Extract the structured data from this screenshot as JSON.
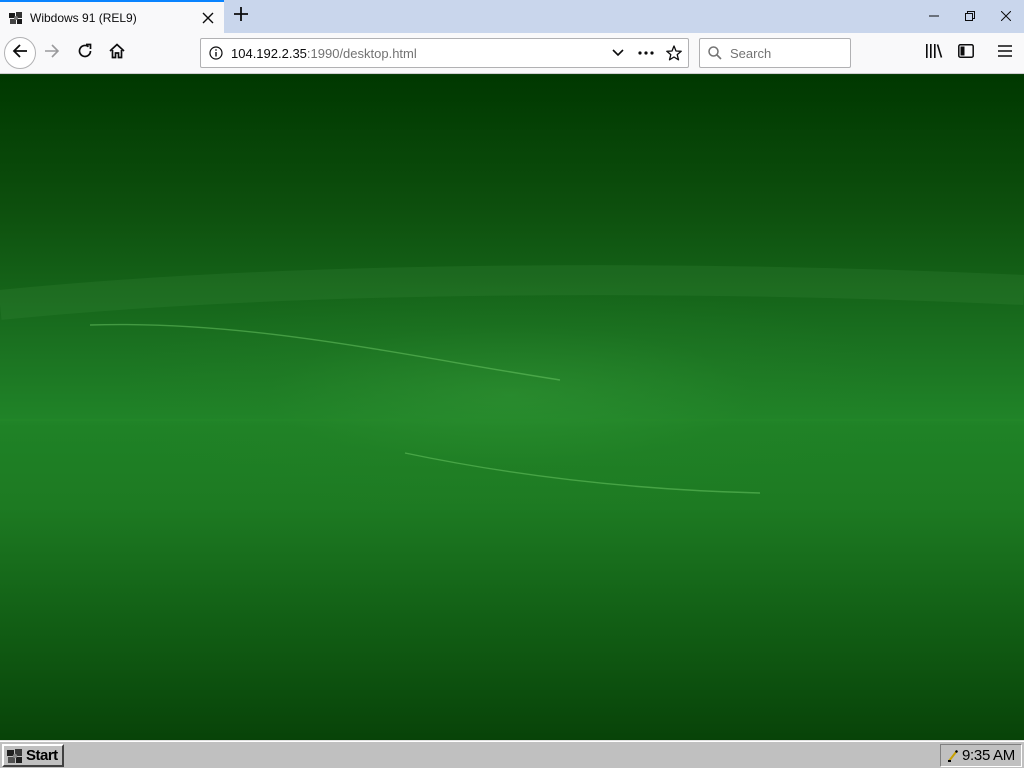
{
  "browser": {
    "tab": {
      "title": "Wibdows 91 (REL9)",
      "favicon": "wibdows-logo-icon"
    },
    "new_tab_icon": "plus-icon",
    "window_controls": [
      "minimize-icon",
      "restore-icon",
      "close-icon"
    ],
    "nav": {
      "back_icon": "arrow-left-icon",
      "forward_icon": "arrow-right-icon",
      "reload_icon": "reload-icon",
      "home_icon": "home-icon"
    },
    "urlbar": {
      "host": "104.192.2.35",
      "rest": ":1990/desktop.html",
      "info_icon": "info-icon",
      "actions": [
        "chevron-down-icon",
        "more-icon",
        "star-icon"
      ]
    },
    "search": {
      "placeholder": "Search",
      "value": ""
    },
    "toolbar": [
      "library-icon",
      "sidebar-icon",
      "hamburger-menu-icon"
    ]
  },
  "taskbar": {
    "start_label": "Start",
    "clock": "9:35 AM",
    "tray_icon": "speaker-icon"
  },
  "colors": {
    "desktop_top": "#003800",
    "desktop_mid": "#208428",
    "desktop_bottom": "#084308",
    "taskbar": "#c0c0c0",
    "tab_accent": "#0a84ff"
  }
}
